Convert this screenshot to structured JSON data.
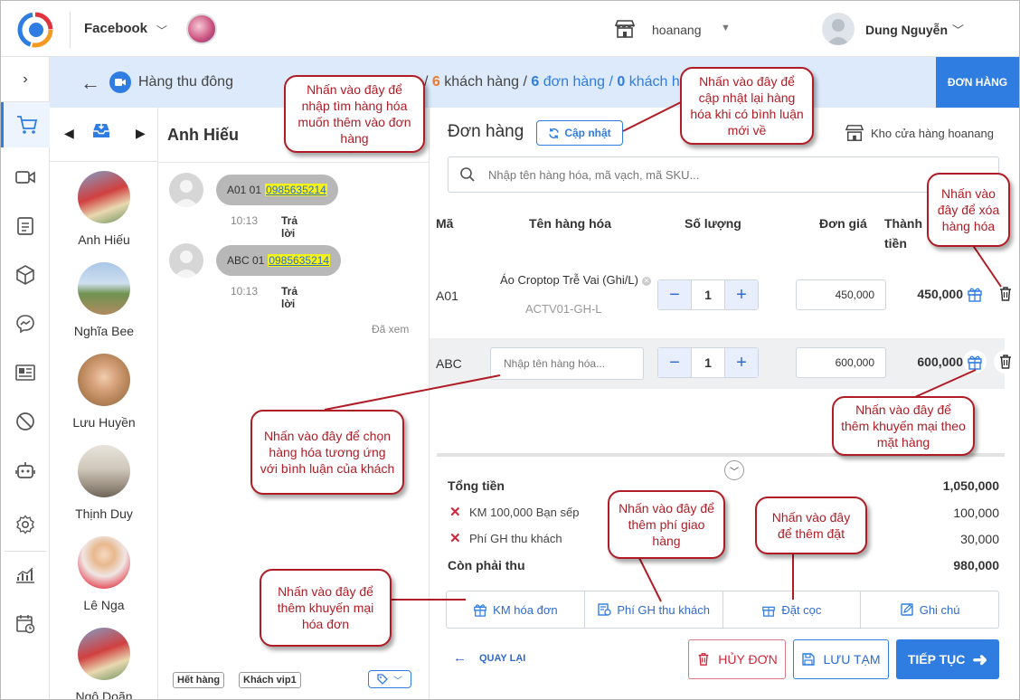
{
  "topbar": {
    "page_name": "Facebook",
    "store_name": "hoanang",
    "user_name": "Dung Nguyễn"
  },
  "subbar": {
    "title": "Hàng thu đông",
    "stat_prefix": "/",
    "customers_count": "6",
    "customers_label": "khách hàng /",
    "orders_count": "6",
    "orders_label": "đơn hàng /",
    "zero_count": "0",
    "zero_label": "khách h",
    "tab_label": "ĐƠN HÀNG"
  },
  "contacts": [
    {
      "name": "Anh Hiếu"
    },
    {
      "name": "Nghĩa Bee"
    },
    {
      "name": "Lưu Huyền"
    },
    {
      "name": "Thịnh Duy"
    },
    {
      "name": "Lê Nga"
    },
    {
      "name": "Ngô Doãn"
    }
  ],
  "chat": {
    "name": "Anh Hiếu",
    "messages": [
      {
        "prefix": "A01 01",
        "phone": "0985635214",
        "time": "10:13",
        "reply": "Trả lời"
      },
      {
        "prefix": "ABC 01",
        "phone": "0985635214",
        "time": "10:13",
        "reply": "Trả lời"
      }
    ],
    "seen": "Đã xem",
    "tags": [
      "Hết hàng",
      "Khách vip1"
    ]
  },
  "order": {
    "title": "Đơn hàng",
    "update_label": "Cập nhật",
    "warehouse": "Kho cửa hàng hoanang",
    "search_placeholder": "Nhập tên hàng hóa, mã vạch, mã SKU...",
    "columns": {
      "code": "Mã",
      "name": "Tên hàng hóa",
      "qty": "Số lượng",
      "price": "Đơn giá",
      "total_line1": "Thành",
      "total_line2": "tiền"
    },
    "items": [
      {
        "code": "A01",
        "name": "Áo Croptop Trễ Vai (Ghi/L)",
        "sku": "ACTV01-GH-L",
        "qty": "1",
        "price": "450,000",
        "amount": "450,000"
      },
      {
        "code": "ABC",
        "name_placeholder": "Nhập tên hàng hóa...",
        "qty": "1",
        "price": "600,000",
        "amount": "600,000"
      }
    ],
    "summary": {
      "total_label": "Tổng tiền",
      "total_value": "1,050,000",
      "discount_label": "KM 100,000 Bạn sếp",
      "discount_value": "100,000",
      "shipping_label": "Phí GH thu khách",
      "shipping_value": "30,000",
      "due_label": "Còn phải thu",
      "due_value": "980,000"
    },
    "actions": [
      "KM hóa đơn",
      "Phí GH thu khách",
      "Đặt cọc",
      "Ghi chú"
    ],
    "back_label": "QUAY LẠI",
    "cancel_label": "HỦY ĐƠN",
    "save_label": "LƯU TẠM",
    "next_label": "TIẾP TỤC"
  },
  "callouts": {
    "search": "Nhấn vào đây để nhập tìm hàng hóa muốn thêm vào đơn hàng",
    "update": "Nhấn vào đây để cập nhật lại hàng hóa khi có bình luận mới về",
    "delete": "Nhấn vào đây để xóa hàng hóa",
    "item_promo": "Nhấn vào đây để thêm khuyến mại theo mặt hàng",
    "choose": "Nhấn vào đây để chọn hàng hóa tương ứng với bình luận của khách",
    "shipping": "Nhấn vào đây để thêm phí giao hàng",
    "deposit": "Nhấn vào đây để thêm đặt",
    "invoice_promo": "Nhấn vào đây để thêm khuyến mại hóa đơn"
  },
  "colors": {
    "accent": "#2f7de1",
    "callout": "#b01c25",
    "cancel": "#d0263a",
    "highlight": "#f5f21a"
  }
}
